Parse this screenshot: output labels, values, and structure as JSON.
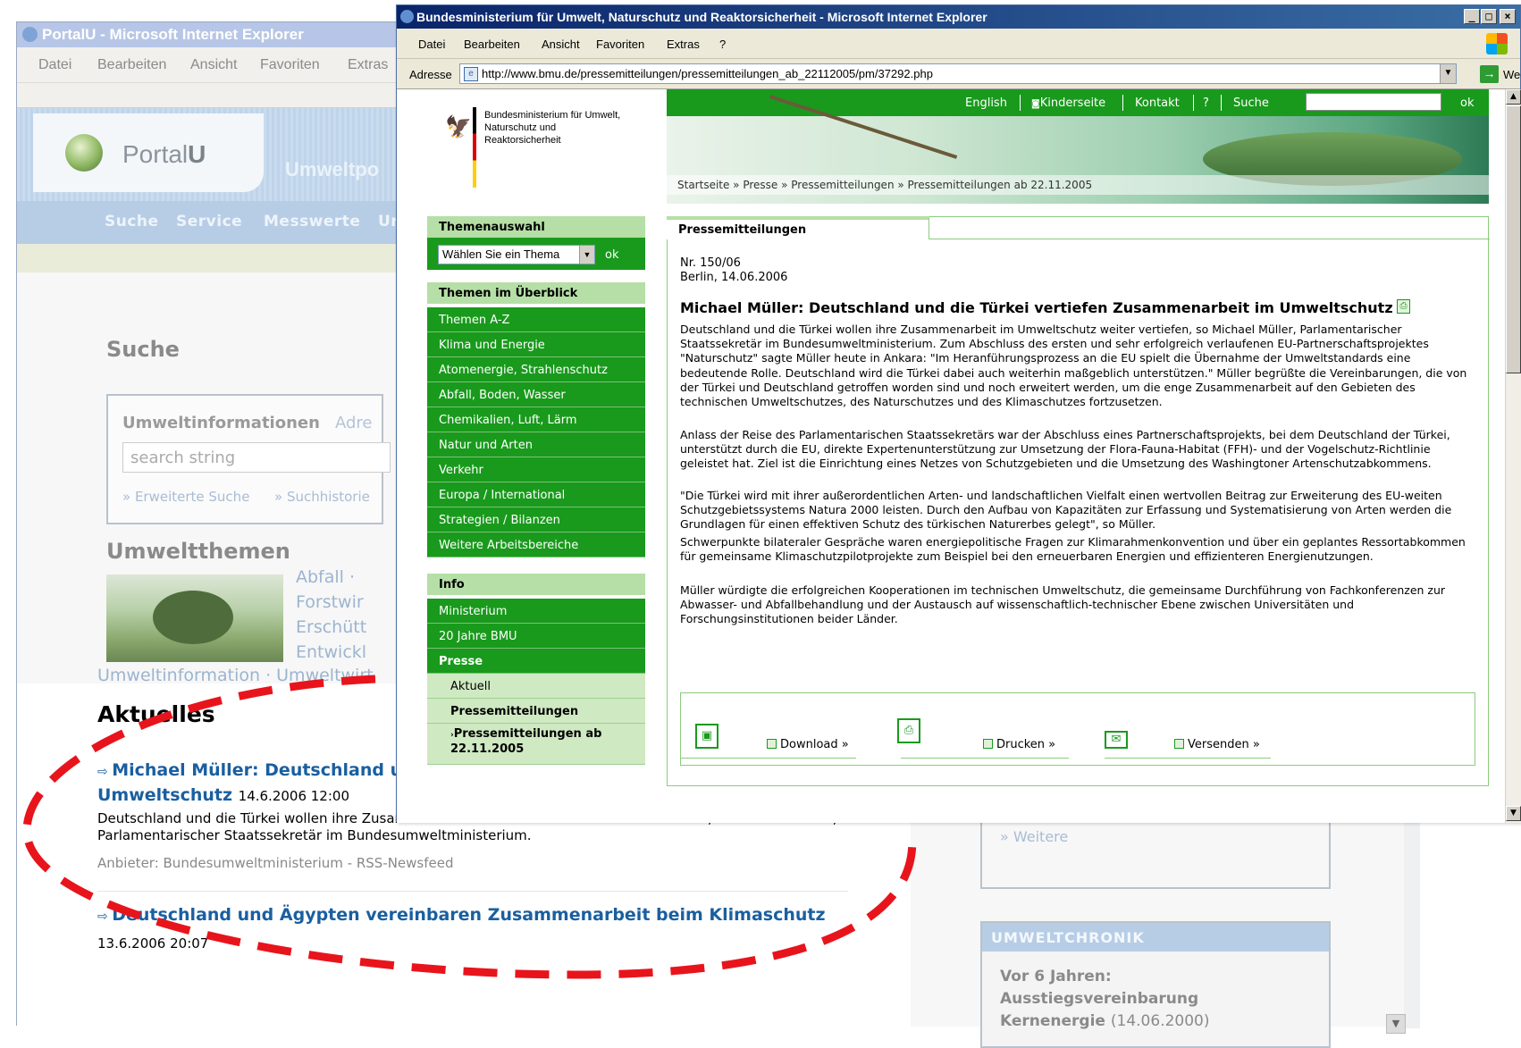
{
  "back_window": {
    "title": "PortalU - Microsoft Internet Explorer",
    "menu": [
      "Datei",
      "Bearbeiten",
      "Ansicht",
      "Favoriten",
      "Extras"
    ],
    "logo_text": "Portal",
    "logo_bold": "U",
    "header_title": "Umweltpo",
    "nav": [
      "Suche",
      "Service",
      "Messwerte",
      "Ur"
    ],
    "search_heading": "Suche",
    "search_tab": "Umweltinformationen",
    "search_tab2": "Adre",
    "search_placeholder": "search string",
    "search_links": [
      "» Erweiterte Suche",
      "» Suchhistorie"
    ],
    "topics_heading": "Umweltthemen",
    "topics": [
      "Abfall ·",
      "Forstwir",
      "Erschütt",
      "Entwickl"
    ],
    "topics_row": "Umweltinformation · Umweltwirt",
    "news_heading": "Aktuelles",
    "news": [
      {
        "title_line1": "Michael Müller: Deutschland und die Türkei vertiefen Zusammenarbeit im",
        "title_line2": "Umweltschutz",
        "date": "14.6.2006 12:00",
        "text": "Deutschland und die Türkei wollen ihre Zusammenarbeit im Umweltschutz weiter vertiefen, so Michael Müller, Parlamentarischer Staatssekretär im Bundesumweltministerium.",
        "provider": "Anbieter: Bundesumweltministerium - RSS-Newsfeed"
      },
      {
        "title_line1": "Deutschland und Ägypten vereinbaren Zusammenarbeit beim Klimaschutz",
        "date": "13.6.2006 20:07"
      }
    ],
    "weitere": "»  Weitere",
    "chronik_heading": "UMWELTCHRONIK",
    "chronik_line1": "Vor 6 Jahren:",
    "chronik_line2": "Ausstiegsvereinbarung",
    "chronik_line3": "Kernenergie",
    "chronik_date": "(14.06.2000)"
  },
  "front_window": {
    "title": "Bundesministerium für Umwelt, Naturschutz und Reaktorsicherheit - Microsoft Internet Explorer",
    "menu": [
      "Datei",
      "Bearbeiten",
      "Ansicht",
      "Favoriten",
      "Extras",
      "?"
    ],
    "address_label": "Adresse",
    "url": "http://www.bmu.de/pressemitteilungen/pressemitteilungen_ab_22112005/pm/37292.php",
    "go_label": "Wechseln zu",
    "logo_text": "Bundesministerium für Umwelt, Naturschutz und Reaktorsicherheit",
    "top_links": [
      "English",
      "Kinderseite",
      "Kontakt",
      "?",
      "Suche"
    ],
    "top_ok": "ok",
    "breadcrumb": "Startseite » Presse » Pressemitteilungen » Pressemitteilungen ab 22.11.2005",
    "themenauswahl": "Themenauswahl",
    "theme_select": "Wählen Sie ein Thema",
    "theme_ok": "ok",
    "themen_heading": "Themen im Überblick",
    "themen": [
      "Themen A-Z",
      "Klima und Energie",
      "Atomenergie, Strahlenschutz",
      "Abfall, Boden, Wasser",
      "Chemikalien, Luft, Lärm",
      "Natur und Arten",
      "Verkehr",
      "Europa / International",
      "Strategien / Bilanzen",
      "Weitere Arbeitsbereiche"
    ],
    "info_heading": "Info",
    "info": [
      "Ministerium",
      "20 Jahre BMU",
      "Presse"
    ],
    "presse_sub": [
      "Aktuell",
      "Pressemitteilungen",
      "Pressemitteilungen ab 22.11.2005"
    ],
    "main_tab": "Pressemitteilungen",
    "pm_nr": "Nr. 150/06",
    "pm_date": "Berlin, 14.06.2006",
    "pm_title": "Michael Müller: Deutschland und die Türkei vertiefen Zusammenarbeit im Umweltschutz",
    "paragraphs": [
      "Deutschland und die Türkei wollen ihre Zusammenarbeit im Umweltschutz weiter vertiefen, so Michael Müller, Parlamentarischer Staatssekretär im Bundesumweltministerium. Zum Abschluss des ersten und sehr erfolgreich verlaufenen EU-Partnerschaftsprojektes \"Naturschutz\" sagte Müller heute in Ankara: \"Im Heranführungsprozess an die EU spielt die Übernahme der Umweltstandards eine bedeutende Rolle. Deutschland wird die Türkei dabei auch weiterhin maßgeblich unterstützen.\" Müller begrüßte die Vereinbarungen, die von der Türkei und Deutschland getroffen worden sind und noch erweitert werden, um die enge Zusammenarbeit auf den Gebieten des technischen Umweltschutzes, des Naturschutzes und des Klimaschutzes fortzusetzen.",
      "Anlass der Reise des Parlamentarischen Staatssekretärs war der Abschluss eines Partnerschaftsprojekts, bei dem Deutschland der Türkei, unterstützt durch die EU, direkte Expertenunterstützung zur Umsetzung der Flora-Fauna-Habitat (FFH)- und der Vogelschutz-Richtlinie geleistet hat. Ziel ist die Einrichtung eines Netzes von Schutzgebieten und die Umsetzung des Washingtoner Artenschutzabkommens.",
      "\"Die Türkei wird mit ihrer außerordentlichen Arten- und landschaftlichen Vielfalt einen wertvollen Beitrag zur Erweiterung des EU-weiten Schutzgebietssystems Natura 2000 leisten. Durch den Aufbau von Kapazitäten zur Erfassung und Systematisierung von Arten werden die Grundlagen für einen effektiven Schutz des türkischen Naturerbes gelegt\", so Müller.",
      "Schwerpunkte bilateraler Gespräche waren energiepolitische Fragen zur Klimarahmenkonvention und über ein geplantes Ressortabkommen für gemeinsame Klimaschutzpilotprojekte zum Beispiel bei den erneuerbaren Energien und effizienteren Energienutzungen.",
      "Müller würdigte die erfolgreichen Kooperationen im technischen Umweltschutz, die gemeinsame Durchführung von Fachkonferenzen zur Abwasser- und Abfallbehandlung und der Austausch auf wissenschaftlich-technischer Ebene zwischen Universitäten und Forschungsinstitutionen beider Länder."
    ],
    "actions": [
      "Download »",
      "Drucken »",
      "Versenden »"
    ]
  }
}
